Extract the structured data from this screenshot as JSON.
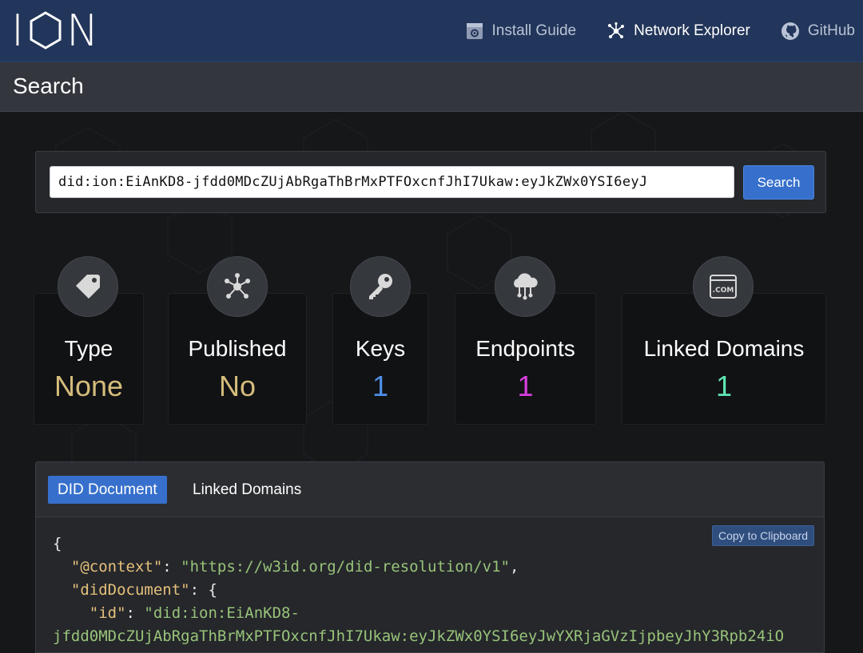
{
  "nav": {
    "logo_text": "N",
    "install_guide": "Install Guide",
    "network_explorer": "Network Explorer",
    "github": "GitHub"
  },
  "page": {
    "title": "Search"
  },
  "search": {
    "value": "did:ion:EiAnKD8-jfdd0MDcZUjAbRgaThBrMxPTFOxcnfJhI7Ukaw:eyJkZWx0YSI6eyJ",
    "button": "Search"
  },
  "stats": [
    {
      "label": "Type",
      "value": "None",
      "color": "#d4bc7b",
      "icon": "tag-icon"
    },
    {
      "label": "Published",
      "value": "No",
      "color": "#d4bc7b",
      "icon": "network-icon"
    },
    {
      "label": "Keys",
      "value": "1",
      "color": "#4f8fe8",
      "icon": "key-icon"
    },
    {
      "label": "Endpoints",
      "value": "1",
      "color": "#d63fe0",
      "icon": "cloud-network-icon"
    },
    {
      "label": "Linked Domains",
      "value": "1",
      "color": "#5fe6b2",
      "icon": "dotcom-icon"
    }
  ],
  "tabs": {
    "did_document": "DID Document",
    "linked_domains": "Linked Domains"
  },
  "copy_button": "Copy to Clipboard",
  "code": {
    "l1": "{",
    "k_context": "\"@context\"",
    "v_context": "\"https://w3id.org/did-resolution/v1\"",
    "k_diddoc": "\"didDocument\"",
    "k_id": "\"id\"",
    "v_id_start": "\"did:ion:EiAnKD8-",
    "v_id_cont": "jfdd0MDcZUjAbRgaThBrMxPTFOxcnfJhI7Ukaw:eyJkZWx0YSI6eyJwYXRjaGVzIjpbeyJhY3Rpb24iO"
  }
}
